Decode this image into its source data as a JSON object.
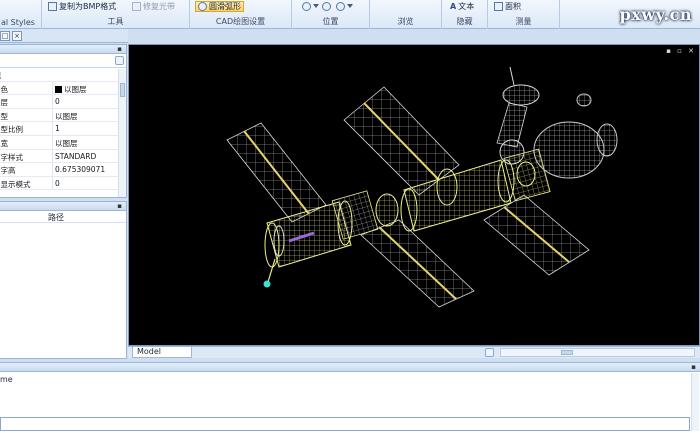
{
  "ribbon": {
    "styles_label": "al Styles",
    "copy_bmp": "复制为BMP格式",
    "repair_light": "修复光带",
    "tools_label": "工具",
    "draw_arc": "圆滑弧形",
    "cad_settings_label": "CAD绘图设置",
    "position_label": "位置",
    "browse_label": "浏览",
    "text_button": "文本",
    "hide_label": "隐藏",
    "area_button": "面积",
    "measure_label": "测量"
  },
  "watermark": "pxwy.cn",
  "properties": {
    "rows": [
      {
        "key": "常规",
        "value": ""
      },
      {
        "key": "颜色",
        "value": "以图层"
      },
      {
        "key": "图层",
        "value": "0"
      },
      {
        "key": "线型",
        "value": "以图层"
      },
      {
        "key": "线型比例",
        "value": "1"
      },
      {
        "key": "线宽",
        "value": "以图层"
      },
      {
        "key": "文字样式",
        "value": "STANDARD"
      },
      {
        "key": "文字高",
        "value": "0.675309071"
      },
      {
        "key": "点显示模式",
        "value": "0"
      }
    ]
  },
  "layers": {
    "path_header": "路径"
  },
  "viewport": {
    "model_tab": "Model"
  },
  "command": {
    "history_text": "me",
    "input_value": ""
  },
  "colors": {
    "wire_white": "#d8d8d8",
    "wire_yellow": "#f0f08a",
    "wire_purple": "#9a6bd8",
    "accent_cyan": "#3fe0d0",
    "ribbon_bg": "#dbe8f7"
  }
}
